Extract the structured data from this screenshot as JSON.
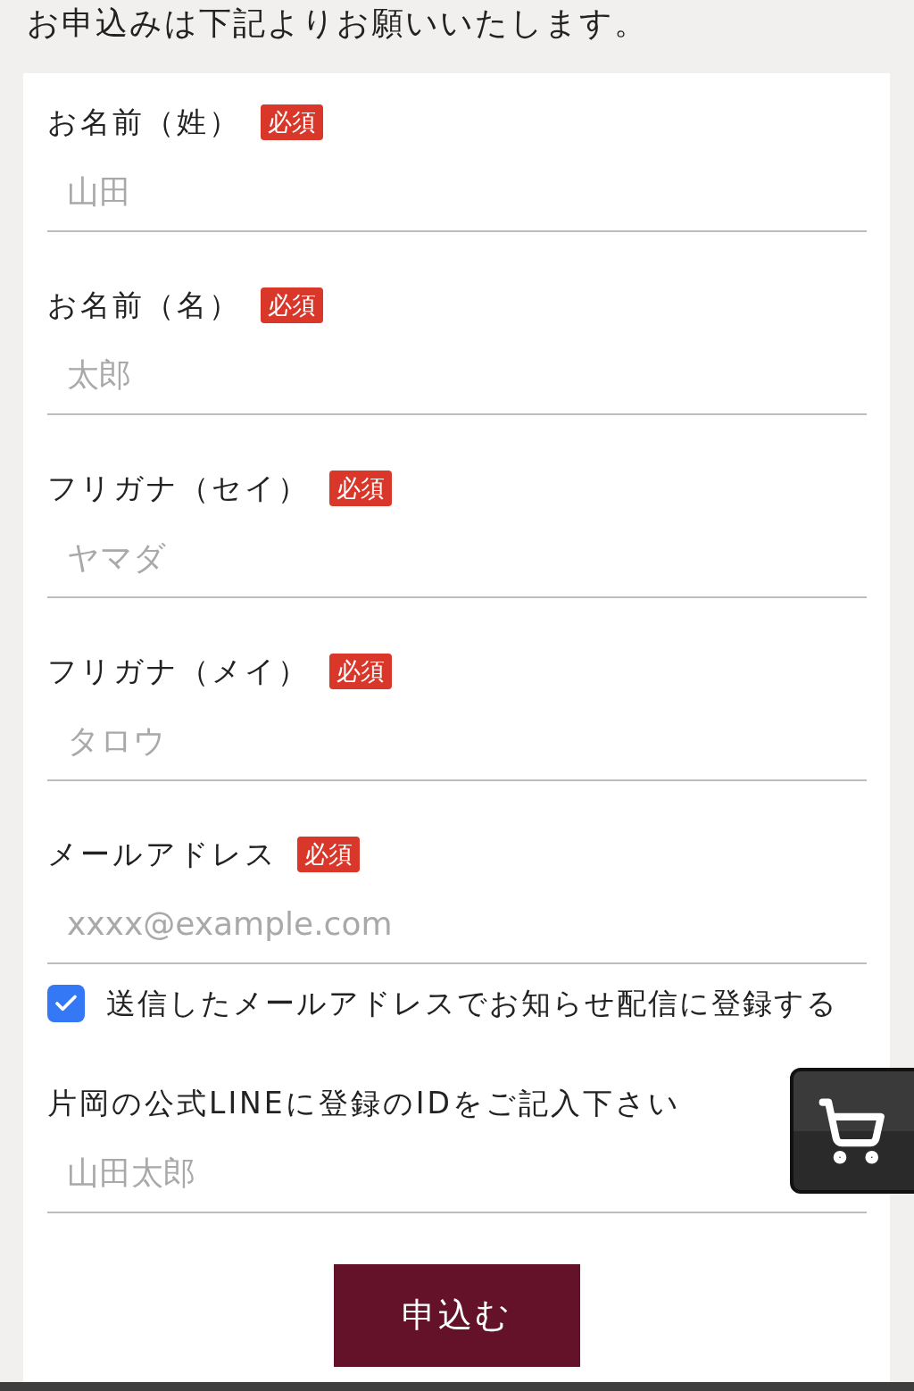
{
  "heading": "お申込みは下記よりお願いいたします。",
  "fields": [
    {
      "label": "お名前（姓）",
      "badge": "必須",
      "placeholder": "山田"
    },
    {
      "label": "お名前（名）",
      "badge": "必須",
      "placeholder": "太郎"
    },
    {
      "label": "フリガナ（セイ）",
      "badge": "必須",
      "placeholder": "ヤマダ"
    },
    {
      "label": "フリガナ（メイ）",
      "badge": "必須",
      "placeholder": "タロウ"
    },
    {
      "label": "メールアドレス",
      "badge": "必須",
      "placeholder": "xxxx@example.com"
    }
  ],
  "subscribe": {
    "label": "送信したメールアドレスでお知らせ配信に登録する",
    "checked": true
  },
  "line_field": {
    "label": "片岡の公式LINEに登録のIDをご記入下さい",
    "placeholder": "山田太郎"
  },
  "submit": "申込む"
}
